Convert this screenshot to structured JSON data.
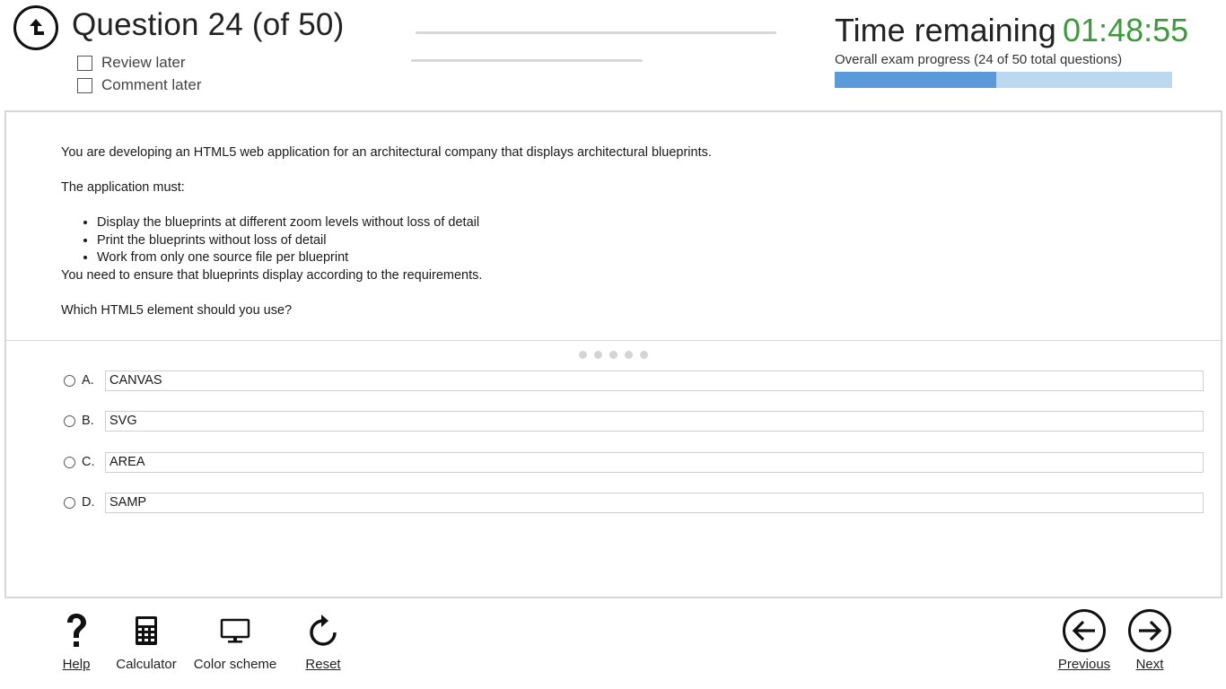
{
  "header": {
    "question_title": "Question 24 (of 50)",
    "review_label": "Review later",
    "comment_label": "Comment later",
    "time_label": "Time remaining",
    "time_value": "01:48:55",
    "progress_text": "Overall exam progress (24 of 50 total questions)",
    "progress_fraction": 0.48,
    "accent_color": "#5a9ad8",
    "time_color": "#3b9a3b"
  },
  "question": {
    "intro": "You are developing an HTML5 web application for an architectural company that displays architectural blueprints.",
    "must": "The application must:",
    "requirements": [
      "Display the blueprints at different zoom levels without loss of detail",
      "Print the blueprints without loss of detail",
      "Work from only one source file per blueprint"
    ],
    "need": "You need to ensure that blueprints display according to the requirements.",
    "prompt": "Which HTML5 element should you use?"
  },
  "options": [
    {
      "letter": "A.",
      "text": "CANVAS"
    },
    {
      "letter": "B.",
      "text": "SVG"
    },
    {
      "letter": "C.",
      "text": "AREA"
    },
    {
      "letter": "D.",
      "text": "SAMP"
    }
  ],
  "toolbar": {
    "help": "Help",
    "calculator": "Calculator",
    "color_scheme": "Color scheme",
    "reset": "Reset",
    "previous": "Previous",
    "next": "Next"
  },
  "icons": {
    "back": "back-up-arrow-icon",
    "help": "question-mark-icon",
    "calculator": "calculator-icon",
    "color_scheme": "monitor-icon",
    "reset": "reset-arrow-icon",
    "previous": "left-arrow-icon",
    "next": "right-arrow-icon"
  }
}
